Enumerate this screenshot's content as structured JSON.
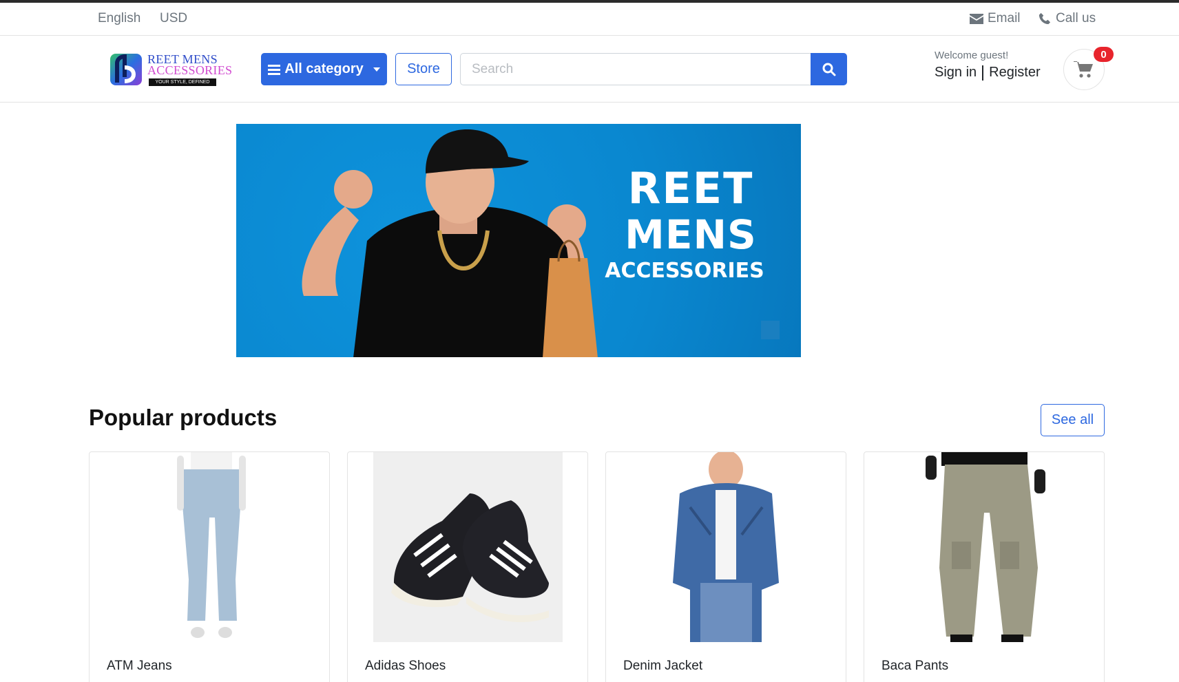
{
  "topbar": {
    "language": "English",
    "currency": "USD",
    "email_label": "Email",
    "call_label": "Call us"
  },
  "header": {
    "logo": {
      "line1": "REET MENS",
      "line2": "ACCESSORIES",
      "tagline": "YOUR STYLE, DEFINED"
    },
    "category_label": "All category",
    "store_label": "Store",
    "search_placeholder": "Search",
    "welcome_text": "Welcome guest!",
    "sign_in": "Sign in",
    "register": "Register",
    "cart_count": "0"
  },
  "banner": {
    "line1": "REET",
    "line2": "MENS",
    "line3": "ACCESSORIES"
  },
  "popular": {
    "title": "Popular products",
    "see_all": "See all",
    "products": [
      {
        "name": "ATM Jeans"
      },
      {
        "name": "Adidas Shoes"
      },
      {
        "name": "Denim Jacket"
      },
      {
        "name": "Baca Pants"
      }
    ]
  },
  "colors": {
    "primary": "#2d68e0",
    "banner_blue": "#0a87cf",
    "badge_red": "#e8242c"
  },
  "icons": [
    "envelope-icon",
    "phone-icon",
    "menu-icon",
    "search-icon",
    "cart-icon"
  ]
}
